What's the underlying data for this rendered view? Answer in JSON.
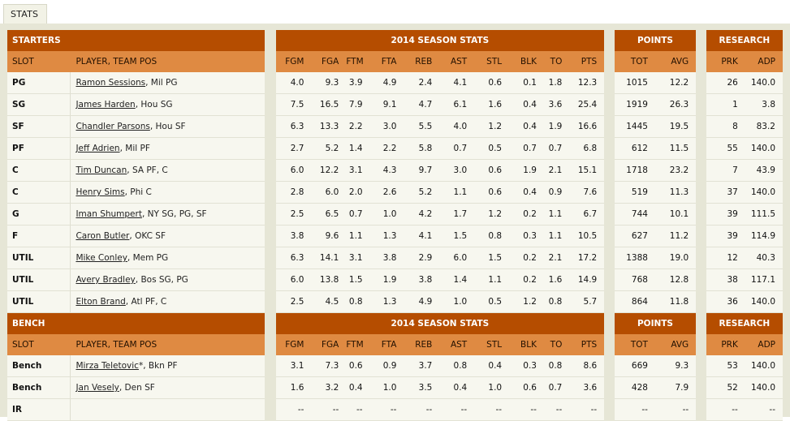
{
  "tab": {
    "label": "STATS"
  },
  "columns": {
    "slot": "SLOT",
    "player": "PLAYER, TEAM POS",
    "stats": [
      "FGM",
      "FGA",
      "FTM",
      "FTA",
      "REB",
      "AST",
      "STL",
      "BLK",
      "TO",
      "PTS"
    ],
    "points": [
      "TOT",
      "AVG"
    ],
    "research": [
      "PRK",
      "ADP"
    ]
  },
  "groups": {
    "season": "2014 SEASON STATS",
    "points": "POINTS",
    "research": "RESEARCH"
  },
  "sections": [
    {
      "title": "STARTERS",
      "rows": [
        {
          "slot": "PG",
          "name": "Ramon Sessions",
          "team": ", Mil PG",
          "stats": [
            "4.0",
            "9.3",
            "3.9",
            "4.9",
            "2.4",
            "4.1",
            "0.6",
            "0.1",
            "1.8",
            "12.3"
          ],
          "tot": "1015",
          "avg": "12.2",
          "prk": "26",
          "adp": "140.0"
        },
        {
          "slot": "SG",
          "name": "James Harden",
          "team": ", Hou SG",
          "stats": [
            "7.5",
            "16.5",
            "7.9",
            "9.1",
            "4.7",
            "6.1",
            "1.6",
            "0.4",
            "3.6",
            "25.4"
          ],
          "tot": "1919",
          "avg": "26.3",
          "prk": "1",
          "adp": "3.8"
        },
        {
          "slot": "SF",
          "name": "Chandler Parsons",
          "team": ", Hou SF",
          "stats": [
            "6.3",
            "13.3",
            "2.2",
            "3.0",
            "5.5",
            "4.0",
            "1.2",
            "0.4",
            "1.9",
            "16.6"
          ],
          "tot": "1445",
          "avg": "19.5",
          "prk": "8",
          "adp": "83.2"
        },
        {
          "slot": "PF",
          "name": "Jeff Adrien",
          "team": ", Mil PF",
          "stats": [
            "2.7",
            "5.2",
            "1.4",
            "2.2",
            "5.8",
            "0.7",
            "0.5",
            "0.7",
            "0.7",
            "6.8"
          ],
          "tot": "612",
          "avg": "11.5",
          "prk": "55",
          "adp": "140.0"
        },
        {
          "slot": "C",
          "name": "Tim Duncan",
          "team": ", SA PF, C",
          "stats": [
            "6.0",
            "12.2",
            "3.1",
            "4.3",
            "9.7",
            "3.0",
            "0.6",
            "1.9",
            "2.1",
            "15.1"
          ],
          "tot": "1718",
          "avg": "23.2",
          "prk": "7",
          "adp": "43.9"
        },
        {
          "slot": "C",
          "name": "Henry Sims",
          "team": ", Phi C",
          "stats": [
            "2.8",
            "6.0",
            "2.0",
            "2.6",
            "5.2",
            "1.1",
            "0.6",
            "0.4",
            "0.9",
            "7.6"
          ],
          "tot": "519",
          "avg": "11.3",
          "prk": "37",
          "adp": "140.0"
        },
        {
          "slot": "G",
          "name": "Iman Shumpert",
          "team": ", NY SG, PG, SF",
          "stats": [
            "2.5",
            "6.5",
            "0.7",
            "1.0",
            "4.2",
            "1.7",
            "1.2",
            "0.2",
            "1.1",
            "6.7"
          ],
          "tot": "744",
          "avg": "10.1",
          "prk": "39",
          "adp": "111.5"
        },
        {
          "slot": "F",
          "name": "Caron Butler",
          "team": ", OKC SF",
          "stats": [
            "3.8",
            "9.6",
            "1.1",
            "1.3",
            "4.1",
            "1.5",
            "0.8",
            "0.3",
            "1.1",
            "10.5"
          ],
          "tot": "627",
          "avg": "11.2",
          "prk": "39",
          "adp": "114.9"
        },
        {
          "slot": "UTIL",
          "name": "Mike Conley",
          "team": ", Mem PG",
          "stats": [
            "6.3",
            "14.1",
            "3.1",
            "3.8",
            "2.9",
            "6.0",
            "1.5",
            "0.2",
            "2.1",
            "17.2"
          ],
          "tot": "1388",
          "avg": "19.0",
          "prk": "12",
          "adp": "40.3"
        },
        {
          "slot": "UTIL",
          "name": "Avery Bradley",
          "team": ", Bos SG, PG",
          "stats": [
            "6.0",
            "13.8",
            "1.5",
            "1.9",
            "3.8",
            "1.4",
            "1.1",
            "0.2",
            "1.6",
            "14.9"
          ],
          "tot": "768",
          "avg": "12.8",
          "prk": "38",
          "adp": "117.1"
        },
        {
          "slot": "UTIL",
          "name": "Elton Brand",
          "team": ", Atl PF, C",
          "stats": [
            "2.5",
            "4.5",
            "0.8",
            "1.3",
            "4.9",
            "1.0",
            "0.5",
            "1.2",
            "0.8",
            "5.7"
          ],
          "tot": "864",
          "avg": "11.8",
          "prk": "36",
          "adp": "140.0"
        }
      ]
    },
    {
      "title": "BENCH",
      "rows": [
        {
          "slot": "Bench",
          "name": "Mirza Teletovic",
          "team": "*, Bkn PF",
          "stats": [
            "3.1",
            "7.3",
            "0.6",
            "0.9",
            "3.7",
            "0.8",
            "0.4",
            "0.3",
            "0.8",
            "8.6"
          ],
          "tot": "669",
          "avg": "9.3",
          "prk": "53",
          "adp": "140.0"
        },
        {
          "slot": "Bench",
          "name": "Jan Vesely",
          "team": ", Den SF",
          "stats": [
            "1.6",
            "3.2",
            "0.4",
            "1.0",
            "3.5",
            "0.4",
            "1.0",
            "0.6",
            "0.7",
            "3.6"
          ],
          "tot": "428",
          "avg": "7.9",
          "prk": "52",
          "adp": "140.0"
        },
        {
          "slot": "IR",
          "name": "",
          "team": "",
          "stats": [
            "--",
            "--",
            "--",
            "--",
            "--",
            "--",
            "--",
            "--",
            "--",
            "--"
          ],
          "tot": "--",
          "avg": "--",
          "prk": "--",
          "adp": "--"
        }
      ]
    }
  ]
}
